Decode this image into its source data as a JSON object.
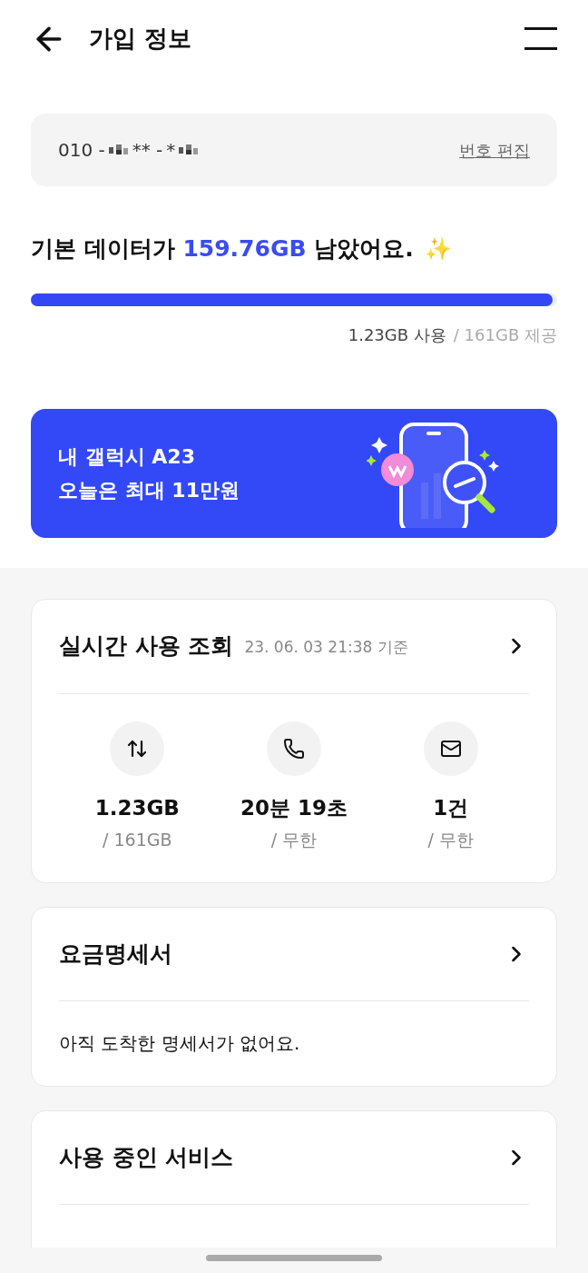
{
  "header": {
    "title": "가입 정보"
  },
  "phone": {
    "prefix": "010 -",
    "middle": "** -",
    "last": "*",
    "edit_link": "번호 편집"
  },
  "data_summary": {
    "headline": "기본 데이터가 **159.76GB** 남았어요.",
    "emoji": "✨",
    "level": 0.992,
    "used": "1.23GB 사용",
    "provided": "/ 161GB 제공"
  },
  "banner": {
    "line1": "내 갤럭시 A23",
    "line2": "오늘은 최대 11만원"
  },
  "realtime": {
    "title": "실시간 사용 조회",
    "timestamp": "23. 06. 03 21:38 기준",
    "stats": [
      {
        "kind": "data",
        "value": "1.23GB",
        "limit": "/ 161GB"
      },
      {
        "kind": "call",
        "value": "20분 19초",
        "limit": "/ 무한"
      },
      {
        "kind": "message",
        "value": "1건",
        "limit": "/ 무한"
      }
    ]
  },
  "bill": {
    "title": "요금명세서",
    "message": "아직 도착한 명세서가 없어요."
  },
  "services": {
    "title": "사용 중인 서비스"
  }
}
